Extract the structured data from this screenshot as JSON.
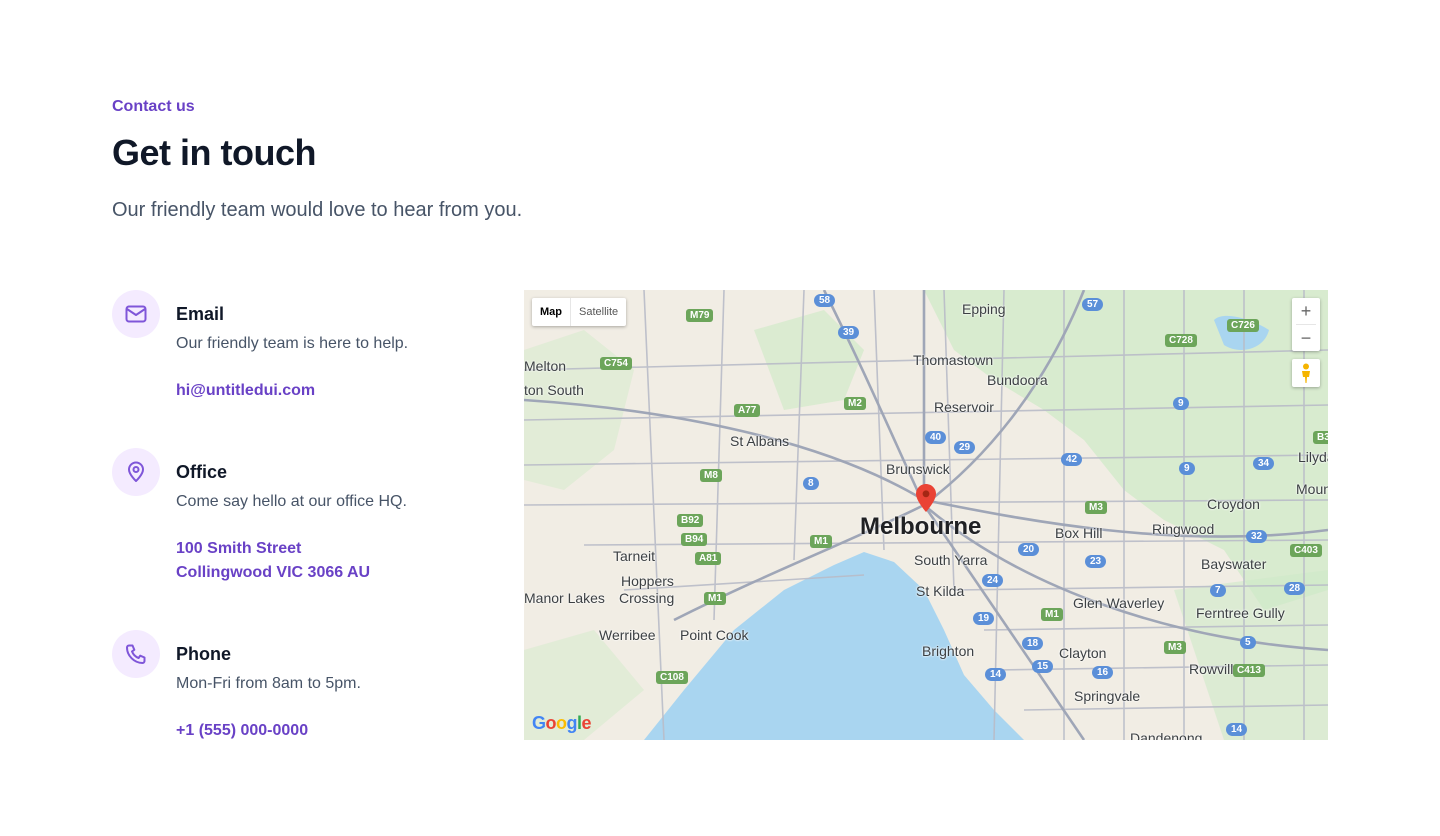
{
  "header": {
    "eyebrow": "Contact us",
    "title": "Get in touch",
    "subtitle": "Our friendly team would love to hear from you."
  },
  "contacts": {
    "email": {
      "icon": "mail-icon",
      "heading": "Email",
      "description": "Our friendly team is here to help.",
      "link": "hi@untitledui.com"
    },
    "office": {
      "icon": "map-pin-icon",
      "heading": "Office",
      "description": "Come say hello at our office HQ.",
      "line1": "100 Smith Street",
      "line2": "Collingwood VIC 3066 AU"
    },
    "phone": {
      "icon": "phone-icon",
      "heading": "Phone",
      "description": "Mon-Fri from 8am to 5pm.",
      "link": "+1 (555) 000-0000"
    }
  },
  "map": {
    "type_map": "Map",
    "type_satellite": "Satellite",
    "zoom_in": "+",
    "zoom_out": "−",
    "logo": "Google",
    "city": "Melbourne",
    "places": {
      "epping": "Epping",
      "melton": "Melton",
      "melton_south": "ton South",
      "thomastown": "Thomastown",
      "bundoora": "Bundoora",
      "reservoir": "Reservoir",
      "st_albans": "St Albans",
      "brunswick": "Brunswick",
      "lilydale": "Lilydal",
      "mount": "Moun",
      "croydon": "Croydon",
      "box_hill": "Box Hill",
      "ringwood": "Ringwood",
      "tarneit": "Tarneit",
      "south_yarra": "South Yarra",
      "bayswater": "Bayswater",
      "hoppers": "Hoppers",
      "crossing": "Crossing",
      "st_kilda": "St Kilda",
      "manor_lakes": "Manor Lakes",
      "glen_waverley": "Glen Waverley",
      "ferntree_gully": "Ferntree Gully",
      "werribee": "Werribee",
      "point_cook": "Point Cook",
      "brighton": "Brighton",
      "clayton": "Clayton",
      "rowville": "Rowville",
      "springvale": "Springvale",
      "dandenong": "Dandenong"
    },
    "roads": {
      "r58": "58",
      "r57": "57",
      "m79": "M79",
      "r39": "39",
      "c726": "C726",
      "c728": "C728",
      "c754": "C754",
      "a77": "A77",
      "m2": "M2",
      "r9a": "9",
      "r40": "40",
      "r29": "29",
      "b3": "B3",
      "m8": "M8",
      "r42": "42",
      "r34": "34",
      "r9b": "9",
      "r8": "8",
      "m3a": "M3",
      "b92": "B92",
      "b94": "B94",
      "m1a": "M1",
      "r20": "20",
      "r32": "32",
      "c403": "C403",
      "a81": "A81",
      "r23": "23",
      "r24": "24",
      "r28": "28",
      "r7": "7",
      "m1b": "M1",
      "m1c": "M1",
      "r19": "19",
      "r18": "18",
      "m3b": "M3",
      "r5": "5",
      "r15": "15",
      "r16": "16",
      "c413": "C413",
      "c108": "C108",
      "r14a": "14",
      "r14b": "14"
    }
  }
}
